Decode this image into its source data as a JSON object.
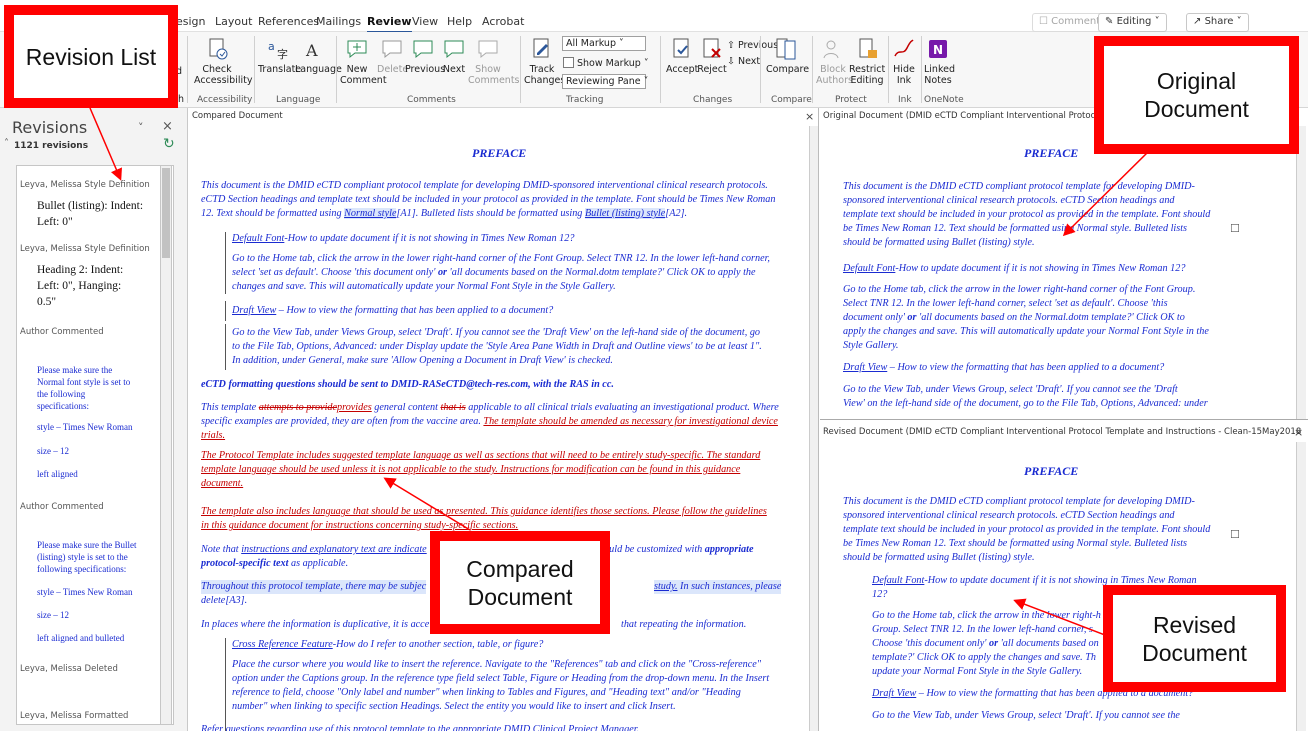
{
  "ribbon": {
    "tabs": [
      "esign",
      "Layout",
      "References",
      "Mailings",
      "Review",
      "View",
      "Help",
      "Acrobat"
    ],
    "active_tab": "Review",
    "top_buttons": {
      "comments": "Comments",
      "editing": "Editing",
      "share": "Share"
    },
    "buttons": {
      "check_accessibility": "Check Accessibility",
      "translate": "Translate",
      "language": "Language",
      "new_comment": "New Comment",
      "delete": "Delete",
      "previous": "Previous",
      "next": "Next",
      "show_comments": "Show Comments",
      "track_changes": "Track Changes",
      "all_markup": "All Markup",
      "show_markup": "Show Markup",
      "reviewing_pane": "Reviewing Pane",
      "accept": "Accept",
      "reject": "Reject",
      "previous_change": "Previous",
      "next_change": "Next",
      "compare": "Compare",
      "block_authors": "Block Authors",
      "restrict_editing": "Restrict Editing",
      "hide_ink": "Hide Ink",
      "linked_notes": "Linked Notes"
    },
    "groups": {
      "accessibility": "Accessibility",
      "language": "Language",
      "comments": "Comments",
      "tracking": "Tracking",
      "changes": "Changes",
      "compare": "Compare",
      "protect": "Protect",
      "ink": "Ink",
      "onenote": "OneNote"
    },
    "partial_left": {
      "a": "d",
      "b": "h"
    }
  },
  "revisions": {
    "title": "Revisions",
    "count": "1121 revisions",
    "items": [
      {
        "author": "Leyva, Melissa Style Definition",
        "detail_1": "Bullet (listing): Indent:",
        "detail_2": "Left: 0\""
      },
      {
        "author": "Leyva, Melissa Style Definition",
        "detail_1": "Heading 2: Indent:",
        "detail_2": "Left: 0\", Hanging:",
        "detail_3": "0.5\""
      },
      {
        "author": "Author Commented",
        "c1": "Please make sure the",
        "c2": "Normal font style is set to",
        "c3": "the following",
        "c4": "specifications:",
        "c5": "style – Times New Roman",
        "c6": "size – 12",
        "c7": "left aligned"
      },
      {
        "author": "Author Commented",
        "c1": "Please make sure the Bullet",
        "c2": "(listing) style is set to the",
        "c3": "following specifications:",
        "c4": "style – Times New Roman",
        "c5": "size – 12",
        "c6": "left aligned and bulleted"
      },
      {
        "author": "Leyva, Melissa Deleted"
      },
      {
        "author": "Leyva, Melissa Formatted"
      }
    ]
  },
  "compared": {
    "header": "Compared Document",
    "title": "PREFACE",
    "p1_l1": "This document is the DMID eCTD compliant protocol template for developing DMID-sponsored interventional clinical research protocols.",
    "p1_l2": "eCTD Section headings and template text should be included in your protocol as provided in the template. Font should be Times New Roman",
    "p1_l3a": "12.  Text should be formatted using ",
    "p1_l3b": "Normal style",
    "p1_l3c": "[A1]",
    "p1_l3d": ". Bulleted lists should be formatted using ",
    "p1_l3e": "Bullet (listing) style",
    "p1_l3f": "[A2]",
    "p1_l3g": ".",
    "df_title": "Default Font",
    "df_q": "-How to update document if it is not showing in Times New Roman 12?",
    "df_l1": "Go to the Home tab, click the arrow in the lower right-hand corner of the Font Group.  Select TNR 12.  In the lower left-hand corner,",
    "df_l2a": "select 'set as default'.  Choose 'this document only' ",
    "df_l2b": "or",
    "df_l2c": " 'all documents based on the Normal.dotm template?' Click OK to apply the",
    "df_l3": "changes and save.  This will automatically update your Normal Font Style in the Style Gallery.",
    "dv_title": "Draft View",
    "dv_q": " – How to view the formatting that has been applied to a document?",
    "dv_l1": "Go to the View Tab, under Views Group, select 'Draft'.  If you cannot see the 'Draft View' on the left-hand side of the document, go",
    "dv_l2": "to the File Tab, Options, Advanced: under Display update the 'Style Area Pane Width in Draft and Outline views' to be at least 1\".",
    "dv_l3": "In addition, under General, make sure 'Allow Opening a Document in Draft View' is checked.",
    "ectd": "eCTD formatting questions should be sent to DMID-RASeCTD@tech-res.com, with the RAS in cc.",
    "t1_a": "This template ",
    "t1_b": "attempts to provide",
    "t1_c": "provides",
    "t1_d": " general content ",
    "t1_e": "that is",
    "t1_f": " applicable to all clinical trials evaluating an investigational product. Where",
    "t1_l2a": "specific examples are provided, they are often from the vaccine area. ",
    "t1_l2b": "The template should be amended as necessary for investigational device",
    "t1_l3": "trials.",
    "pt_l1": "The Protocol Template includes suggested template language as well as sections that will need to be entirely study-specific.  The standard",
    "pt_l2": "template language should be used unless it is not applicable to the study.  Instructions for modification can be found in this guidance",
    "pt_l3": "document.",
    "tl_l1": "The template also includes language that should be used as presented.  This guidance identifies those sections.  Please follow the guidelines",
    "tl_l2": "in this guidance document for instructions concerning study-specific sections.",
    "nt_a": "Note that ",
    "nt_b": "instructions and explanatory text are indicate",
    "nt_c": "should be customized with ",
    "nt_d": "appropriate",
    "nt_l2a": "protocol-specific text",
    "nt_l2b": " as applicable.",
    "th_a": "Throughout this protocol template, there may be subjec",
    "th_b": "study.",
    "th_c": " In such instances, please",
    "th_l2": "delete[A3].",
    "ip_a": "In places where the information is duplicative, it is acce",
    "ip_b": "that repeating the information.",
    "cr_title": "Cross Reference Feature",
    "cr_q": "-How do I refer to another section, table, or figure?",
    "cr_l1": "Place the cursor where you would like to insert the reference.  Navigate to the \"References\" tab and click on the \"Cross-reference\"",
    "cr_l2": "option under the Captions group.  In the reference type field select Table, Figure or Heading from the drop-down menu.  In the Insert",
    "cr_l3": "reference to field, choose \"Only label and number\" when linking to Tables and Figures, and \"Heading text\" and/or \"Heading",
    "cr_l4": "number\" when linking to specific section Headings.  Select the entity you would like to insert and click Insert.",
    "rq": "Refer questions regarding use of this protocol template to the appropriate DMID Clinical Project Manager."
  },
  "original": {
    "header": "Original Document (DMID eCTD Compliant Interventional Protocol Template and",
    "title": "PREFACE",
    "p1_l1": "This document is the DMID eCTD compliant protocol template for developing DMID-",
    "p1_l2": "sponsored interventional clinical research protocols. eCTD Section headings and",
    "p1_l3": "template text should be included in your protocol as provided in the template. Font should",
    "p1_l4": "be Times New Roman 12.  Text should be formatted using Normal style. Bulleted lists",
    "p1_l5": "should be formatted using Bullet (listing) style.",
    "df_title": "Default Font",
    "df_q": "-How to update document if it is not showing in Times New Roman 12?",
    "df_l1": "Go to the Home tab, click the arrow in the lower right-hand corner of the Font Group.",
    "df_l2": "Select TNR 12.  In the lower left-hand corner, select 'set as default'.  Choose 'this",
    "df_l3a": "document only' ",
    "df_l3b": "or",
    "df_l3c": " 'all documents based on the Normal.dotm template?' Click OK to",
    "df_l4": "apply the changes and save.  This will automatically update your Normal Font Style in the",
    "df_l5": "Style Gallery.",
    "dv_title": "Draft View",
    "dv_q": " – How to view the formatting that has been applied to a document?",
    "dv_l1": "Go to the View Tab, under Views Group, select 'Draft'.  If you cannot see the 'Draft",
    "dv_l2": "View' on the left-hand side of the document, go to the File Tab, Options, Advanced: under"
  },
  "revised": {
    "header": "Revised Document (DMID eCTD Compliant Interventional Protocol Template and Instructions - Clean-15May2018",
    "title": "PREFACE",
    "p1_l1": "This document is the DMID eCTD compliant protocol template for developing DMID-",
    "p1_l2": "sponsored interventional clinical research protocols. eCTD Section headings and",
    "p1_l3": "template text should be included in your protocol as provided in the template. Font should",
    "p1_l4": "be Times New Roman 12.  Text should be formatted using Normal style. Bulleted lists",
    "p1_l5": "should be formatted using Bullet (listing) style.",
    "df_title": "Default Font",
    "df_q": "-How to update document if it is not showing in Times New Roman",
    "df_q2": "12?",
    "df_l1": "Go to the Home tab, click the arrow in the lower right-h",
    "df_l2": "Group.  Select TNR 12.  In the lower left-hand corner, s",
    "df_l3a": "Choose 'this document only' ",
    "df_l3b": "or",
    "df_l3c": " 'all documents based on",
    "df_l4": "template?' Click OK to apply the changes and save.  Th",
    "df_l5": "update your Normal Font Style in the Style Gallery.",
    "dv_title": "Draft View",
    "dv_q": " – How to view the formatting that has been applied to a document?",
    "dv_l1": "Go to the View Tab, under Views Group, select 'Draft'.  If you cannot see the"
  },
  "callouts": {
    "revision_list": "Revision List",
    "original_document": "Original Document",
    "compared_document": "Compared Document",
    "revised_document": "Revised Document"
  },
  "colors": {
    "annotation": "#ff0000",
    "revision_blue": "#1a2bd1",
    "deletion_red": "#c40000",
    "ribbon_accent": "#2b579a"
  }
}
